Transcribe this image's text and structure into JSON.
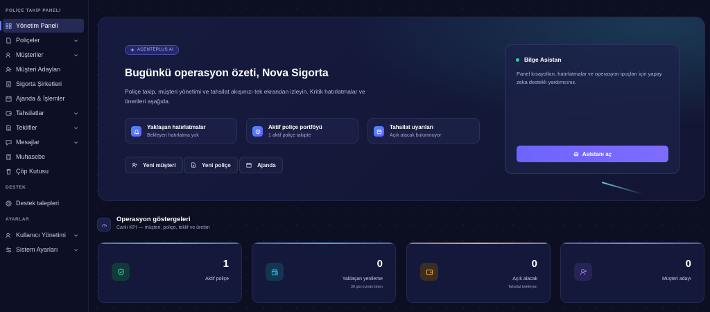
{
  "sidebar": {
    "section_policy": "POLİÇE TAKİP PANELİ",
    "section_support": "DESTEK",
    "section_settings": "AYARLAR",
    "items": [
      {
        "label": "Yönetim Paneli",
        "icon": "dashboard-icon"
      },
      {
        "label": "Poliçeler",
        "icon": "document-icon"
      },
      {
        "label": "Müşteriler",
        "icon": "users-icon"
      },
      {
        "label": "Müşteri Adayları",
        "icon": "user-plus-icon"
      },
      {
        "label": "Sigorta Şirketleri",
        "icon": "building-icon"
      },
      {
        "label": "Ajanda & İşlemler",
        "icon": "calendar-icon"
      },
      {
        "label": "Tahsilatlar",
        "icon": "wallet-icon"
      },
      {
        "label": "Teklifler",
        "icon": "document-icon"
      },
      {
        "label": "Mesajlar",
        "icon": "message-icon"
      },
      {
        "label": "Muhasebe",
        "icon": "calculator-icon"
      },
      {
        "label": "Çöp Kutusu",
        "icon": "trash-icon"
      }
    ],
    "support_items": [
      {
        "label": "Destek talepleri",
        "icon": "support-icon"
      }
    ],
    "settings_items": [
      {
        "label": "Kullanıcı Yönetimi",
        "icon": "users-icon"
      },
      {
        "label": "Sistem Ayarları",
        "icon": "settings-icon"
      }
    ]
  },
  "hero": {
    "badge": "ACENTEPLUS AI",
    "title": "Bugünkü operasyon özeti, Nova Sigorta",
    "description": "Poliçe takip, müşteri yönetimi ve tahsilat akışınızı tek ekrandan izleyin. Kritik hatırlatmalar ve önerileri aşağıda.",
    "cards": [
      {
        "title": "Yaklaşan hatırlatmalar",
        "subtitle": "Bekleyen hatırlatma yok"
      },
      {
        "title": "Aktif poliçe portföyü",
        "subtitle": "1 aktif poliçe takipte"
      },
      {
        "title": "Tahsilat uyarıları",
        "subtitle": "Açık alacak bulunmuyor"
      }
    ],
    "actions": [
      {
        "label": "Yeni müşteri"
      },
      {
        "label": "Yeni poliçe"
      },
      {
        "label": "Ajanda"
      }
    ]
  },
  "assistant": {
    "title": "Bilge Asistan",
    "description": "Panel kısayolları, hatırlatmalar ve operasyon ipuçları için yapay zeka destekli yardımcınız.",
    "button": "Asistanı aç"
  },
  "operations": {
    "title": "Operasyon göstergeleri",
    "subtitle": "Canlı KPI — müşteri, poliçe, teklif ve üretim",
    "kpis": [
      {
        "value": "1",
        "label": "Aktif poliçe",
        "sub": "",
        "accent": "#34d399",
        "icon": "shield-check-icon"
      },
      {
        "value": "0",
        "label": "Yaklaşan yenileme",
        "sub": "30 gün içinde biten",
        "accent": "#22b8e8",
        "icon": "calendar-clock-icon"
      },
      {
        "value": "0",
        "label": "Açık alacak",
        "sub": "Tahsilat bekleyen",
        "accent": "#f4a63a",
        "icon": "wallet-icon"
      },
      {
        "value": "0",
        "label": "Müşteri adayı",
        "sub": "",
        "accent": "#8a7cff",
        "icon": "user-plus-icon"
      }
    ]
  }
}
